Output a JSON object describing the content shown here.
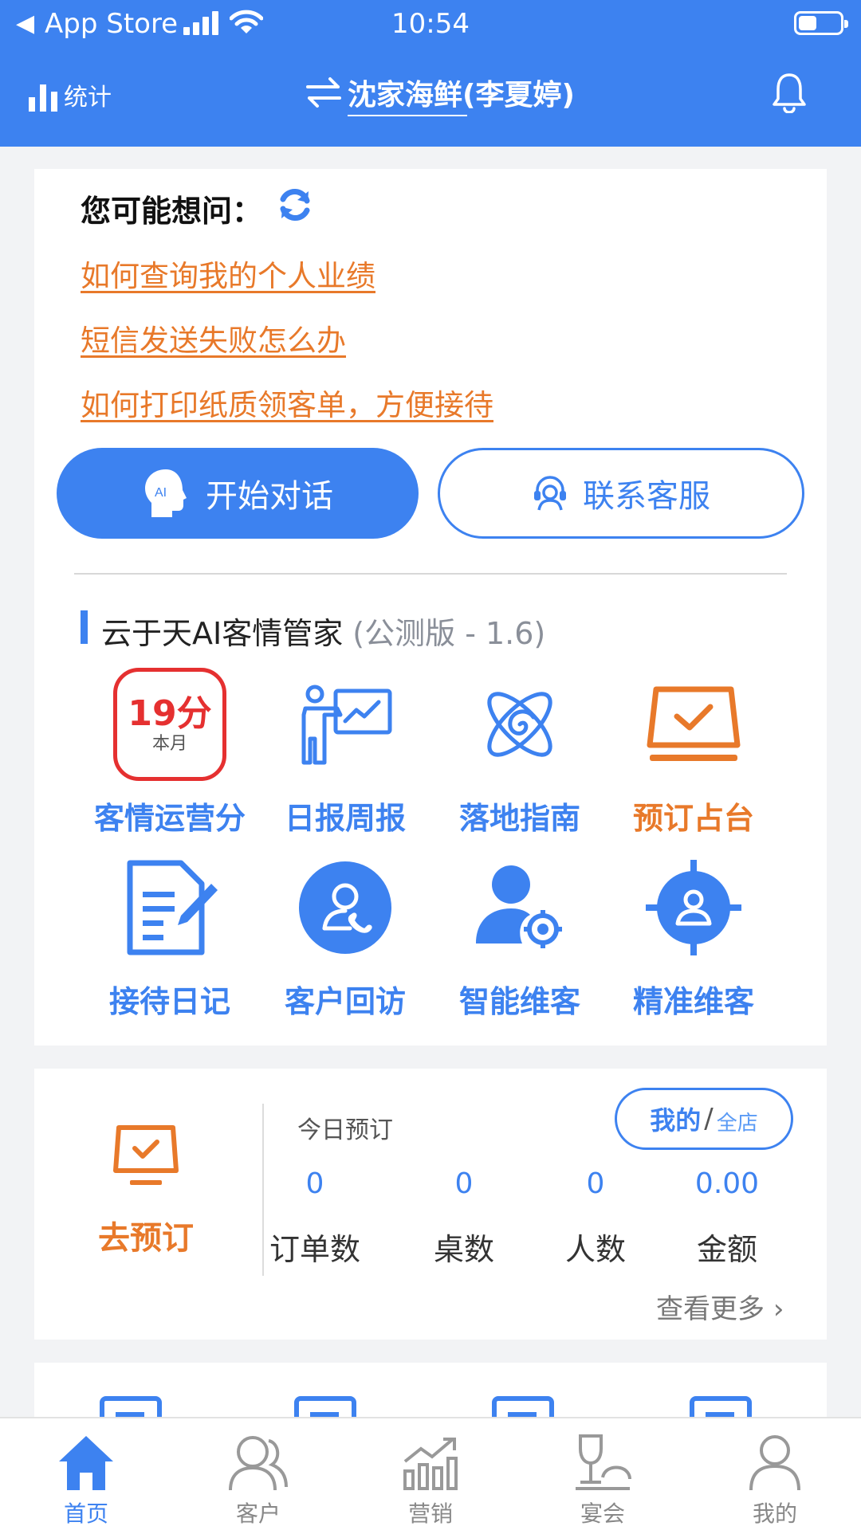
{
  "status_bar": {
    "carrier": "App Store",
    "time": "10:54"
  },
  "nav": {
    "stats_label": "统计",
    "store_title": "沈家海鲜(李夏婷)"
  },
  "ask": {
    "heading": "您可能想问：",
    "questions": [
      "如何查询我的个人业绩",
      "短信发送失败怎么办",
      "如何打印纸质领客单，方便接待"
    ],
    "chat_button": "开始对话",
    "chat_icon_text": "AI",
    "service_button": "联系客服"
  },
  "assistant": {
    "title": "云于天AI客情管家",
    "subtitle": "(公测版 - 1.6)",
    "score_value": "19分",
    "score_period": "本月",
    "features": [
      "客情运营分",
      "日报周报",
      "落地指南",
      "预订占台",
      "接待日记",
      "客户回访",
      "智能维客",
      "精准维客"
    ]
  },
  "booking": {
    "go_label": "去预订",
    "today_label": "今日预订",
    "toggle_mine": "我的",
    "toggle_sep": "/",
    "toggle_all": "全店",
    "stats": [
      {
        "value": "0",
        "label": "订单数"
      },
      {
        "value": "0",
        "label": "桌数"
      },
      {
        "value": "0",
        "label": "人数"
      },
      {
        "value": "0.00",
        "label": "金额"
      }
    ],
    "more": "查看更多"
  },
  "tabbar": {
    "tabs": [
      "首页",
      "客户",
      "营销",
      "宴会",
      "我的"
    ],
    "active": "首页"
  },
  "colors": {
    "primary": "#3d82f0",
    "accent_orange": "#e8792a",
    "score_red": "#e53030"
  }
}
